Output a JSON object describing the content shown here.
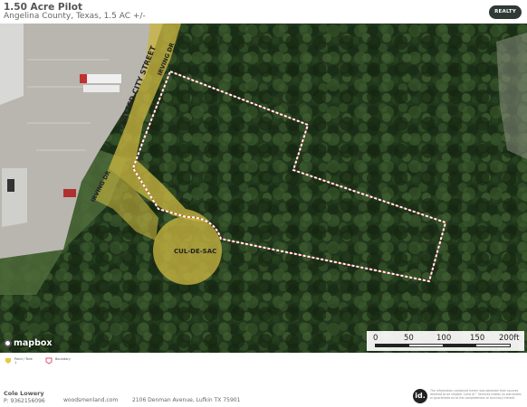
{
  "header": {
    "title": "1.50 Acre Pilot",
    "subtitle": "Angelina County, Texas, 1.5 AC +/-",
    "brand_label": "REALTY"
  },
  "map": {
    "street_labels": {
      "platted_city_street": "PLATTED CITY STREET",
      "irving_dr_upper": "IRVING DR",
      "irving_dr_lower": "IRVING DR",
      "cul_de_sac": "CUL-DE-SAC"
    },
    "attribution": "mapbox",
    "scale": {
      "ticks": [
        "0",
        "50",
        "100",
        "150",
        "200ft"
      ]
    }
  },
  "legend": {
    "items": [
      {
        "label": "Pond / Tank\n1",
        "icon": "pond-swatch",
        "color": "#e8c840"
      },
      {
        "label": "Boundary",
        "icon": "boundary-swatch",
        "color": "#d9556b"
      }
    ]
  },
  "footer": {
    "agent": "Cole Lowery",
    "phone": "P: 9362156096",
    "website": "woodsmenland.com",
    "address": "2106 Denman Avenue, Lufkin TX 75901",
    "logo_text": "id.",
    "disclaimer": "The information contained herein was obtained from sources deemed to be reliable. Land id™ Services makes no warranties or guarantees as to the completeness or accuracy thereof."
  },
  "colors": {
    "boundary": "#ffffff",
    "boundary_dash_accent": "#e0303a",
    "road_fill": "#c9b540",
    "forest": "#1f3a1a"
  }
}
